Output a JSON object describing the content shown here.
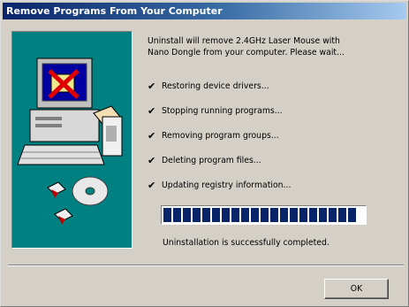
{
  "window": {
    "title": "Remove Programs From Your Computer"
  },
  "message": "Uninstall will remove 2.4GHz Laser Mouse with Nano Dongle from your computer.  Please wait...",
  "steps": [
    {
      "label": "Restoring device drivers...",
      "status": "done"
    },
    {
      "label": "Stopping running programs...",
      "status": "done"
    },
    {
      "label": "Removing program groups...",
      "status": "done"
    },
    {
      "label": "Deleting program files...",
      "status": "done"
    },
    {
      "label": "Updating registry information...",
      "status": "done"
    }
  ],
  "check_glyph": "✔",
  "progress": {
    "fraction": 1.0,
    "block_color": "#0a246a"
  },
  "completion_message": "Uninstallation is successfully completed.",
  "buttons": {
    "ok": "OK"
  },
  "colors": {
    "titlebar": "#0a246a",
    "art_background": "#008080",
    "dialog": "#d4d0c8"
  }
}
